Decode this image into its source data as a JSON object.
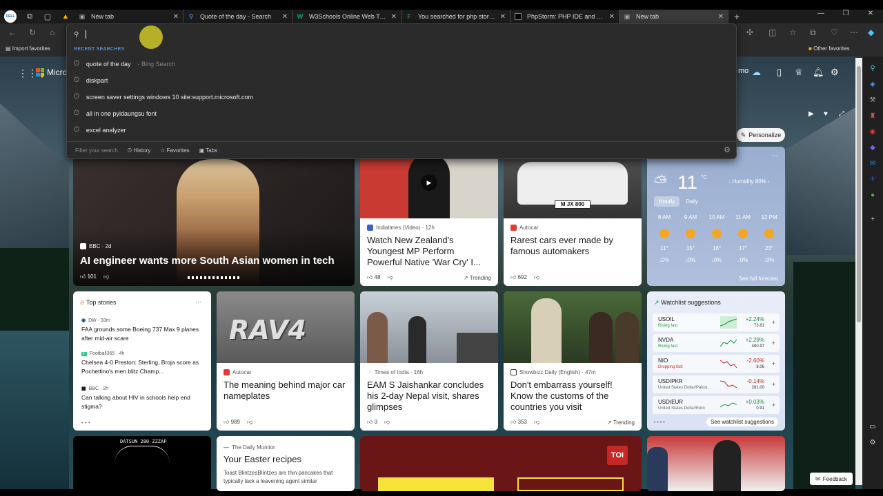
{
  "tabs": [
    {
      "title": "New tab",
      "active": false
    },
    {
      "title": "Quote of the day - Search",
      "active": false
    },
    {
      "title": "W3Schools Online Web Tutorials",
      "active": false
    },
    {
      "title": "You searched for php storm | File",
      "active": false
    },
    {
      "title": "PhpStorm: PHP IDE and Code Edi",
      "active": false
    },
    {
      "title": "New tab",
      "active": true
    }
  ],
  "bookmarks": {
    "import": "Import favorites",
    "other": "Other favorites"
  },
  "search": {
    "recent_label": "RECENT SEARCHES",
    "items": [
      {
        "text": "quote of the day",
        "sub": "- Bing Search"
      },
      {
        "text": "diskpart",
        "sub": ""
      },
      {
        "text": "screen saver settings windows 10 site:support.microsoft.com",
        "sub": ""
      },
      {
        "text": "all in one pyidaungsu font",
        "sub": ""
      },
      {
        "text": "excel analyzer",
        "sub": ""
      }
    ],
    "filter_placeholder": "Filter your search",
    "filters": [
      "History",
      "Favorites",
      "Tabs"
    ]
  },
  "header": {
    "logo_text": "Micro",
    "partial_text": "mo",
    "personalize": "Personalize"
  },
  "hero": {
    "source": "BBC · 2d",
    "title": "AI engineer wants more South Asian women in tech",
    "likes": "101"
  },
  "cards": [
    {
      "source": "Indiatimes (Video) · 12h",
      "title": "Watch New Zealand's Youngest MP Perform Powerful Native 'War Cry' I...",
      "likes": "48",
      "trend": "Trending"
    },
    {
      "source": "Autocar",
      "title": "Rarest cars ever made by famous automakers",
      "likes": "692",
      "trend": ""
    },
    {
      "source": "Autocar",
      "title": "The meaning behind major car nameplates",
      "likes": "989",
      "trend": ""
    },
    {
      "source": "Times of India · 16h",
      "title": "EAM S Jaishankar concludes his 2-day Nepal visit, shares glimpses",
      "likes": "3",
      "trend": ""
    },
    {
      "source": "Showbizz Daily (English) · 47m",
      "title": "Don't embarrass yourself! Know the customs of the countries you visit",
      "likes": "353",
      "trend": "Trending"
    },
    {
      "source": "The Daily Monitor",
      "title": "Your Easter recipes",
      "snippet": "Toast BlintzesBlintzes are thin pancakes that typically lack a leavening agent similar",
      "likes": "",
      "trend": ""
    }
  ],
  "top_stories": {
    "title": "Top stories",
    "items": [
      {
        "source": "DW · 33m",
        "title": "FAA grounds some Boeing 737 Max 9 planes after mid-air scare"
      },
      {
        "source": "Football365 · 4h",
        "title": "Chelsea 4-0 Preston: Sterling, Broja score as Pochettino's men blitz Champ..."
      },
      {
        "source": "BBC · 2h",
        "title": "Can talking about HIV in schools help end stigma?"
      }
    ]
  },
  "weather": {
    "temp": "11",
    "unit": "°C",
    "humidity": "Humidity 80%",
    "tabs": [
      "Hourly",
      "Daily"
    ],
    "hours": [
      {
        "time": "8 AM",
        "temp": "11°",
        "precip": "0%"
      },
      {
        "time": "9 AM",
        "temp": "15°",
        "precip": "0%"
      },
      {
        "time": "10 AM",
        "temp": "16°",
        "precip": "0%"
      },
      {
        "time": "11 AM",
        "temp": "17°",
        "precip": "0%"
      },
      {
        "time": "12 PM",
        "temp": "23°",
        "precip": "0%"
      }
    ],
    "footer": "See full forecast"
  },
  "watchlist": {
    "title": "Watchlist suggestions",
    "rows": [
      {
        "sym": "USOIL",
        "sub": "Rising fast",
        "chg": "+2.24%",
        "price": "73.81",
        "dir": "up"
      },
      {
        "sym": "NVDA",
        "sub": "Rising fast",
        "chg": "+2.29%",
        "price": "490.97",
        "dir": "up"
      },
      {
        "sym": "NIO",
        "sub": "Dropping fast",
        "chg": "-2.60%",
        "price": "8.06",
        "dir": "down"
      },
      {
        "sym": "USD/PKR",
        "sub": "United States Dollar/Pakist...",
        "chg": "-0.14%",
        "price": "281.00",
        "dir": "down"
      },
      {
        "sym": "USD/EUR",
        "sub": "United States Dollar/Euro",
        "chg": "+0.03%",
        "price": "0.91",
        "dir": "up"
      }
    ],
    "footer": "See watchlist suggestions"
  },
  "misc": {
    "rav4": "RAV4",
    "toi": "TOI",
    "datsun": "DATSUN 280 ZZZAP",
    "plate": "M JX 800",
    "feedback": "Feedback"
  },
  "colors": {
    "up": "#1a8a3a",
    "down": "#c62828",
    "accent": "#6ab0ff"
  }
}
